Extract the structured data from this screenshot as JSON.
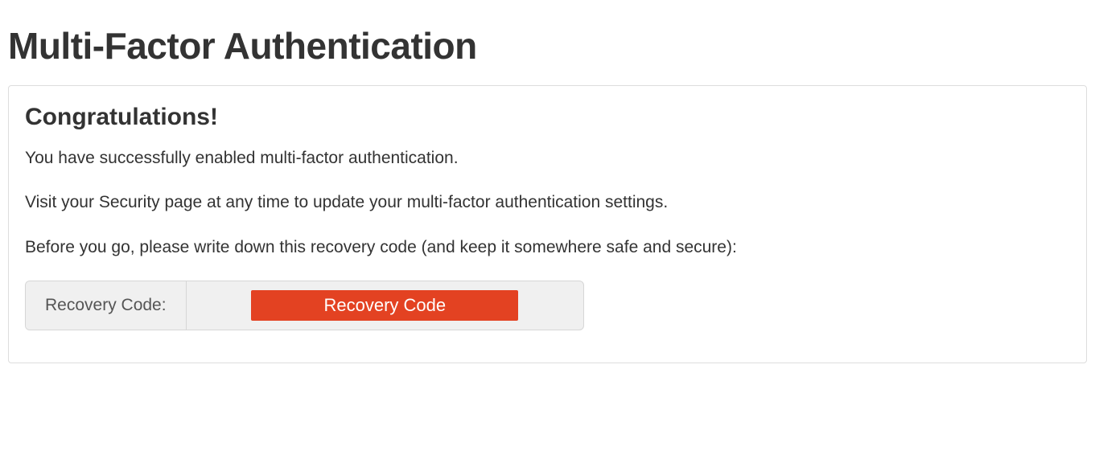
{
  "header": {
    "title": "Multi-Factor Authentication"
  },
  "main": {
    "heading": "Congratulations!",
    "paragraphs": [
      "You have successfully enabled multi-factor authentication.",
      "Visit your Security page at any time to update your multi-factor authentication settings.",
      "Before you go, please write down this recovery code (and keep it somewhere safe and secure):"
    ],
    "recovery": {
      "label": "Recovery Code:",
      "value": "Recovery Code"
    }
  }
}
